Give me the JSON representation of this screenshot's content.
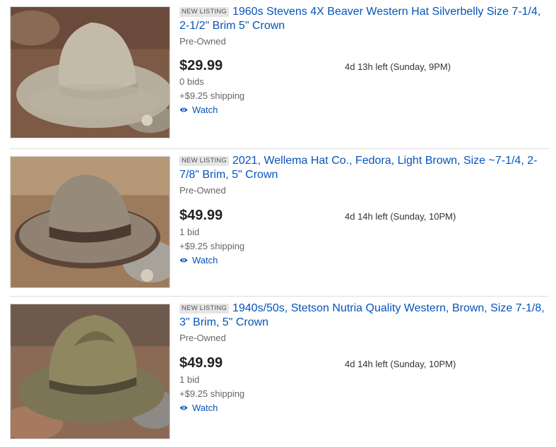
{
  "listings": [
    {
      "badge": "NEW LISTING",
      "title": "1960s Stevens 4X Beaver Western Hat Silverbelly Size 7-1/4, 2-1/2\" Brim 5\" Crown",
      "condition": "Pre-Owned",
      "price": "$29.99",
      "time_left": "4d 13h left (Sunday, 9PM)",
      "bids": "0 bids",
      "shipping": "+$9.25 shipping",
      "watch": "Watch"
    },
    {
      "badge": "NEW LISTING",
      "title": "2021, Wellema Hat Co., Fedora, Light Brown, Size ~7-1/4, 2-7/8\" Brim, 5\" Crown",
      "condition": "Pre-Owned",
      "price": "$49.99",
      "time_left": "4d 14h left (Sunday, 10PM)",
      "bids": "1 bid",
      "shipping": "+$9.25 shipping",
      "watch": "Watch"
    },
    {
      "badge": "NEW LISTING",
      "title": "1940s/50s, Stetson Nutria Quality Western, Brown, Size 7-1/8, 3\" Brim, 5\" Crown",
      "condition": "Pre-Owned",
      "price": "$49.99",
      "time_left": "4d 14h left (Sunday, 10PM)",
      "bids": "1 bid",
      "shipping": "+$9.25 shipping",
      "watch": "Watch"
    }
  ],
  "colors": {
    "link": "#0654ba",
    "price": "#222222",
    "muted": "#666666",
    "badge_bg": "#e5e5e5"
  },
  "icons": {
    "watch": "eye-icon"
  }
}
